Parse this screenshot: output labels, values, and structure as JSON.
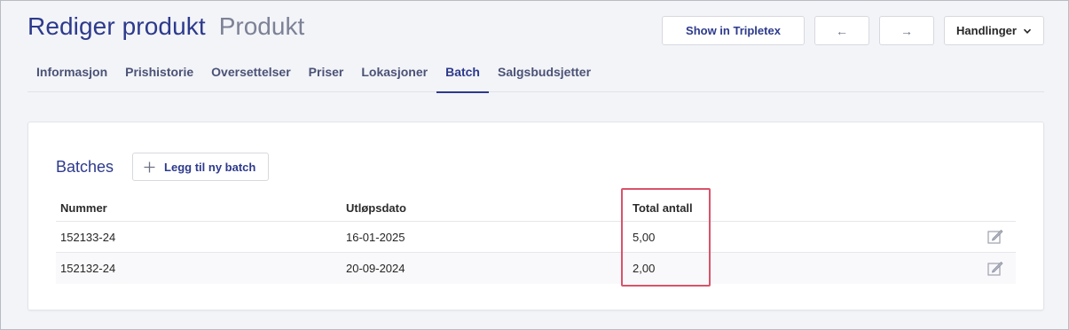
{
  "header": {
    "title": "Rediger produkt",
    "subtitle": "Produkt"
  },
  "actions": {
    "tripletex_label": "Show in Tripletex",
    "prev_label": "←",
    "next_label": "→",
    "menu_label": "Handlinger"
  },
  "tabs": [
    {
      "label": "Informasjon"
    },
    {
      "label": "Prishistorie"
    },
    {
      "label": "Oversettelser"
    },
    {
      "label": "Priser"
    },
    {
      "label": "Lokasjoner"
    },
    {
      "label": "Batch",
      "active": true
    },
    {
      "label": "Salgsbudsjetter"
    }
  ],
  "batches": {
    "title": "Batches",
    "add_label": "Legg til ny batch",
    "columns": [
      "Nummer",
      "Utløpsdato",
      "Total antall"
    ],
    "rows": [
      {
        "number": "152133-24",
        "expiry": "16-01-2025",
        "total": "5,00"
      },
      {
        "number": "152132-24",
        "expiry": "20-09-2024",
        "total": "2,00"
      }
    ]
  },
  "colors": {
    "accent": "#2d3a8c",
    "highlight": "#d9536a"
  },
  "icons": {
    "add": "plus-icon",
    "edit": "edit-icon",
    "menu": "chevron-down-icon"
  }
}
